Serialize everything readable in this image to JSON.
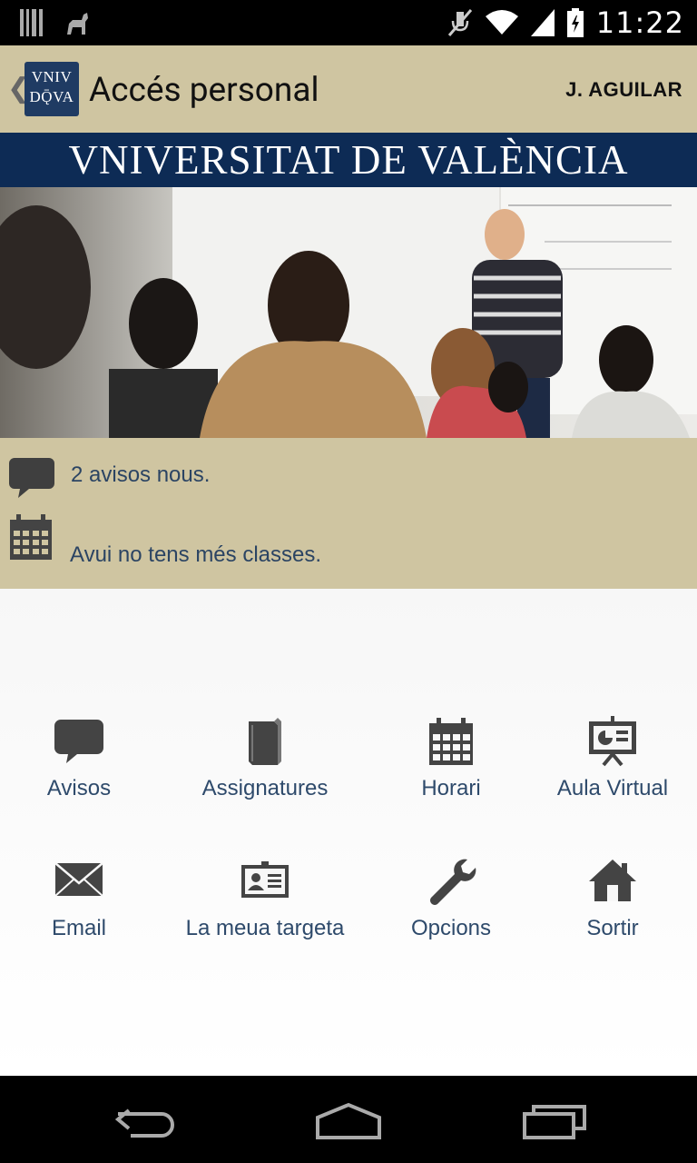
{
  "status_bar": {
    "time": "11:22",
    "icons": [
      "barcode-icon",
      "android-icon",
      "mute-icon",
      "wifi-icon",
      "signal-icon",
      "battery-icon"
    ]
  },
  "action_bar": {
    "back_glyph": "❮",
    "logo_lines": [
      "VNIV",
      "DǬVA"
    ],
    "title": "Accés personal",
    "user": "J. AGUILAR"
  },
  "banner": {
    "text": "VNIVERSITAT DE VALÈNCIA"
  },
  "notifications": {
    "messages": "2 avisos nous.",
    "schedule": "Avui no tens més classes."
  },
  "menu": {
    "items": [
      {
        "label": "Avisos",
        "icon": "speech-bubble-icon"
      },
      {
        "label": "Assignatures",
        "icon": "book-icon"
      },
      {
        "label": "Horari",
        "icon": "calendar-icon"
      },
      {
        "label": "Aula Virtual",
        "icon": "presentation-icon"
      },
      {
        "label": "Email",
        "icon": "envelope-icon"
      },
      {
        "label": "La meua targeta",
        "icon": "id-card-icon"
      },
      {
        "label": "Opcions",
        "icon": "wrench-icon"
      },
      {
        "label": "Sortir",
        "icon": "home-icon"
      }
    ]
  },
  "colors": {
    "action_bar_bg": "#cfc5a1",
    "banner_bg": "#0d2b55",
    "label_color": "#2e4a6b",
    "icon_color": "#4a4a4a"
  }
}
